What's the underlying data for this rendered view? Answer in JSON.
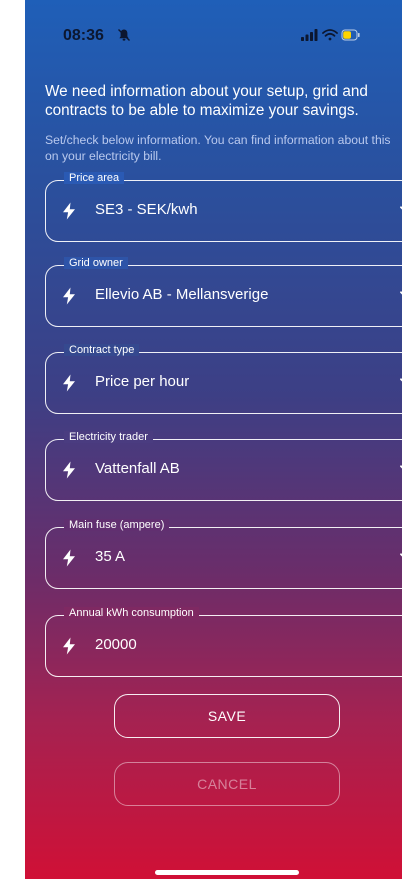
{
  "status_bar": {
    "time": "08:36",
    "icons": [
      "silent-bell-icon",
      "signal-bars-icon",
      "wifi-icon",
      "battery-icon"
    ],
    "battery_color": "#ffd400"
  },
  "intro": "We need information about your setup, grid and contracts to be able to maximize your savings.",
  "note": "Set/check below information. You can find information about this on your electricity bill.",
  "fields": [
    {
      "label": "Price area",
      "value": "SE3 - SEK/kwh",
      "has_dropdown": true
    },
    {
      "label": "Grid owner",
      "value": "Ellevio AB - Mellansverige",
      "has_dropdown": true
    },
    {
      "label": "Contract type",
      "value": "Price per hour",
      "has_dropdown": true
    },
    {
      "label": "Electricity trader",
      "value": "Vattenfall AB",
      "has_dropdown": true
    },
    {
      "label": "Main fuse (ampere)",
      "value": "35 A",
      "has_dropdown": true
    },
    {
      "label": "Annual kWh consumption",
      "value": "20000",
      "has_dropdown": false
    }
  ],
  "buttons": {
    "save": "SAVE",
    "cancel": "CANCEL"
  },
  "colors": {
    "gradient_top": "#1f5fb8",
    "gradient_bottom": "#d01036",
    "note_text": "#b9c9ee"
  }
}
